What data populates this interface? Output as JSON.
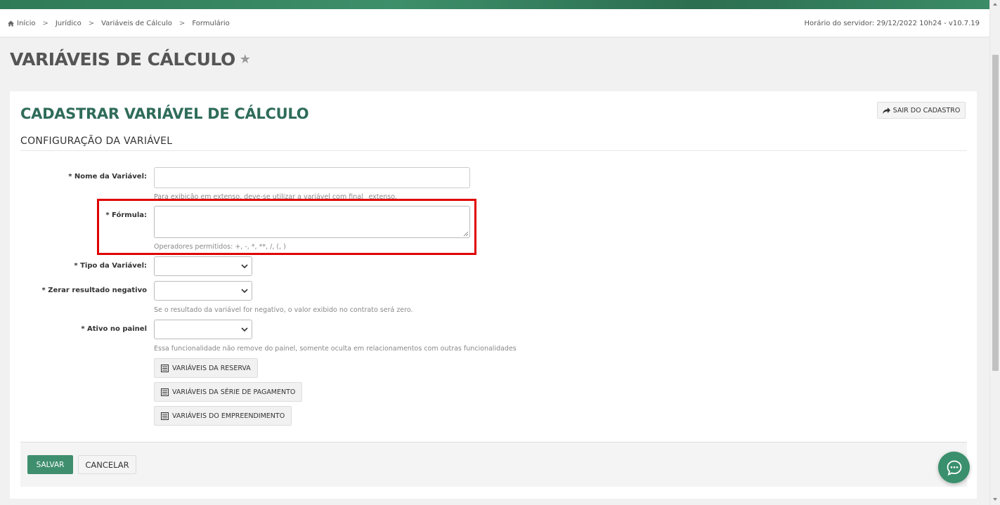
{
  "breadcrumb": {
    "items": [
      "Início",
      "Jurídico",
      "Variáveis de Cálculo",
      "Formulário"
    ]
  },
  "server_time": "Horário do servidor: 29/12/2022 10h24 - v10.7.19",
  "page_title": "VARIÁVEIS DE CÁLCULO",
  "card": {
    "title": "CADASTRAR VARIÁVEL DE CÁLCULO",
    "exit_label": "SAIR DO CADASTRO",
    "section": "CONFIGURAÇÃO DA VARIÁVEL"
  },
  "form": {
    "nome": {
      "label": "* Nome da Variável:",
      "value": "",
      "help": "Para exibição em extenso, deve-se utilizar a variável com final _extenso."
    },
    "formula": {
      "label": "* Fórmula:",
      "value": "",
      "help": "Operadores permitidos: +, -, *, **, /, (, )"
    },
    "tipo": {
      "label": "* Tipo da Variável:",
      "value": ""
    },
    "zerar": {
      "label": "* Zerar resultado negativo",
      "value": "",
      "help": "Se o resultado da variável for negativo, o valor exibido no contrato será zero."
    },
    "ativo": {
      "label": "* Ativo no painel",
      "value": "",
      "help": "Essa funcionalidade não remove do painel, somente oculta em relacionamentos com outras funcionalidades"
    }
  },
  "variable_buttons": [
    "VARIÁVEIS DA RESERVA",
    "VARIÁVEIS DA SÉRIE DE PAGAMENTO",
    "VARIÁVEIS DO EMPREENDIMENTO"
  ],
  "actions": {
    "save": "SALVAR",
    "cancel": "CANCELAR"
  },
  "colors": {
    "brand": "#3f8f6e",
    "title": "#2f6c5a",
    "highlight": "#e00000"
  }
}
